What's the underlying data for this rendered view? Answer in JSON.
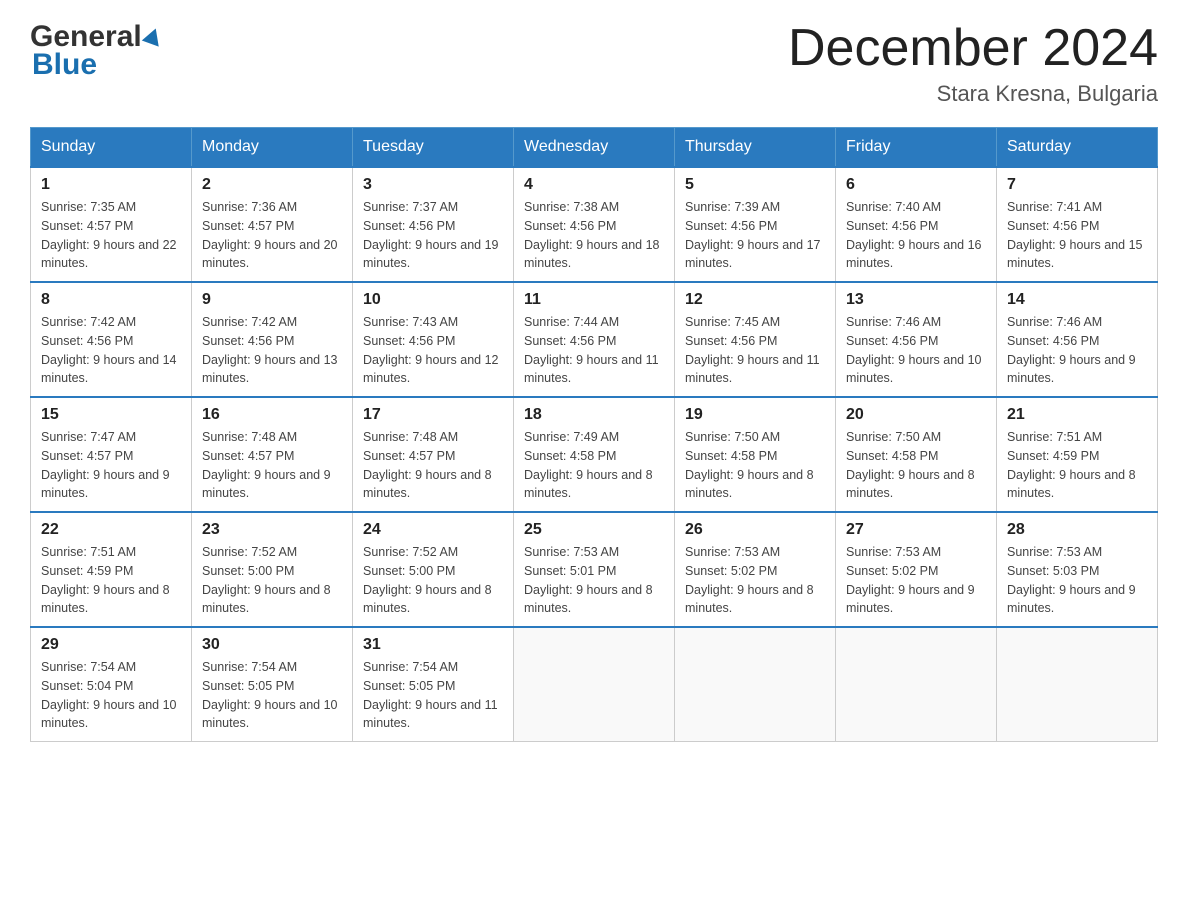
{
  "header": {
    "main_title": "December 2024",
    "subtitle": "Stara Kresna, Bulgaria",
    "logo_general": "General",
    "logo_blue": "Blue"
  },
  "calendar": {
    "days_of_week": [
      "Sunday",
      "Monday",
      "Tuesday",
      "Wednesday",
      "Thursday",
      "Friday",
      "Saturday"
    ],
    "weeks": [
      [
        {
          "day": "1",
          "sunrise": "7:35 AM",
          "sunset": "4:57 PM",
          "daylight": "9 hours and 22 minutes."
        },
        {
          "day": "2",
          "sunrise": "7:36 AM",
          "sunset": "4:57 PM",
          "daylight": "9 hours and 20 minutes."
        },
        {
          "day": "3",
          "sunrise": "7:37 AM",
          "sunset": "4:56 PM",
          "daylight": "9 hours and 19 minutes."
        },
        {
          "day": "4",
          "sunrise": "7:38 AM",
          "sunset": "4:56 PM",
          "daylight": "9 hours and 18 minutes."
        },
        {
          "day": "5",
          "sunrise": "7:39 AM",
          "sunset": "4:56 PM",
          "daylight": "9 hours and 17 minutes."
        },
        {
          "day": "6",
          "sunrise": "7:40 AM",
          "sunset": "4:56 PM",
          "daylight": "9 hours and 16 minutes."
        },
        {
          "day": "7",
          "sunrise": "7:41 AM",
          "sunset": "4:56 PM",
          "daylight": "9 hours and 15 minutes."
        }
      ],
      [
        {
          "day": "8",
          "sunrise": "7:42 AM",
          "sunset": "4:56 PM",
          "daylight": "9 hours and 14 minutes."
        },
        {
          "day": "9",
          "sunrise": "7:42 AM",
          "sunset": "4:56 PM",
          "daylight": "9 hours and 13 minutes."
        },
        {
          "day": "10",
          "sunrise": "7:43 AM",
          "sunset": "4:56 PM",
          "daylight": "9 hours and 12 minutes."
        },
        {
          "day": "11",
          "sunrise": "7:44 AM",
          "sunset": "4:56 PM",
          "daylight": "9 hours and 11 minutes."
        },
        {
          "day": "12",
          "sunrise": "7:45 AM",
          "sunset": "4:56 PM",
          "daylight": "9 hours and 11 minutes."
        },
        {
          "day": "13",
          "sunrise": "7:46 AM",
          "sunset": "4:56 PM",
          "daylight": "9 hours and 10 minutes."
        },
        {
          "day": "14",
          "sunrise": "7:46 AM",
          "sunset": "4:56 PM",
          "daylight": "9 hours and 9 minutes."
        }
      ],
      [
        {
          "day": "15",
          "sunrise": "7:47 AM",
          "sunset": "4:57 PM",
          "daylight": "9 hours and 9 minutes."
        },
        {
          "day": "16",
          "sunrise": "7:48 AM",
          "sunset": "4:57 PM",
          "daylight": "9 hours and 9 minutes."
        },
        {
          "day": "17",
          "sunrise": "7:48 AM",
          "sunset": "4:57 PM",
          "daylight": "9 hours and 8 minutes."
        },
        {
          "day": "18",
          "sunrise": "7:49 AM",
          "sunset": "4:58 PM",
          "daylight": "9 hours and 8 minutes."
        },
        {
          "day": "19",
          "sunrise": "7:50 AM",
          "sunset": "4:58 PM",
          "daylight": "9 hours and 8 minutes."
        },
        {
          "day": "20",
          "sunrise": "7:50 AM",
          "sunset": "4:58 PM",
          "daylight": "9 hours and 8 minutes."
        },
        {
          "day": "21",
          "sunrise": "7:51 AM",
          "sunset": "4:59 PM",
          "daylight": "9 hours and 8 minutes."
        }
      ],
      [
        {
          "day": "22",
          "sunrise": "7:51 AM",
          "sunset": "4:59 PM",
          "daylight": "9 hours and 8 minutes."
        },
        {
          "day": "23",
          "sunrise": "7:52 AM",
          "sunset": "5:00 PM",
          "daylight": "9 hours and 8 minutes."
        },
        {
          "day": "24",
          "sunrise": "7:52 AM",
          "sunset": "5:00 PM",
          "daylight": "9 hours and 8 minutes."
        },
        {
          "day": "25",
          "sunrise": "7:53 AM",
          "sunset": "5:01 PM",
          "daylight": "9 hours and 8 minutes."
        },
        {
          "day": "26",
          "sunrise": "7:53 AM",
          "sunset": "5:02 PM",
          "daylight": "9 hours and 8 minutes."
        },
        {
          "day": "27",
          "sunrise": "7:53 AM",
          "sunset": "5:02 PM",
          "daylight": "9 hours and 9 minutes."
        },
        {
          "day": "28",
          "sunrise": "7:53 AM",
          "sunset": "5:03 PM",
          "daylight": "9 hours and 9 minutes."
        }
      ],
      [
        {
          "day": "29",
          "sunrise": "7:54 AM",
          "sunset": "5:04 PM",
          "daylight": "9 hours and 10 minutes."
        },
        {
          "day": "30",
          "sunrise": "7:54 AM",
          "sunset": "5:05 PM",
          "daylight": "9 hours and 10 minutes."
        },
        {
          "day": "31",
          "sunrise": "7:54 AM",
          "sunset": "5:05 PM",
          "daylight": "9 hours and 11 minutes."
        },
        null,
        null,
        null,
        null
      ]
    ]
  }
}
